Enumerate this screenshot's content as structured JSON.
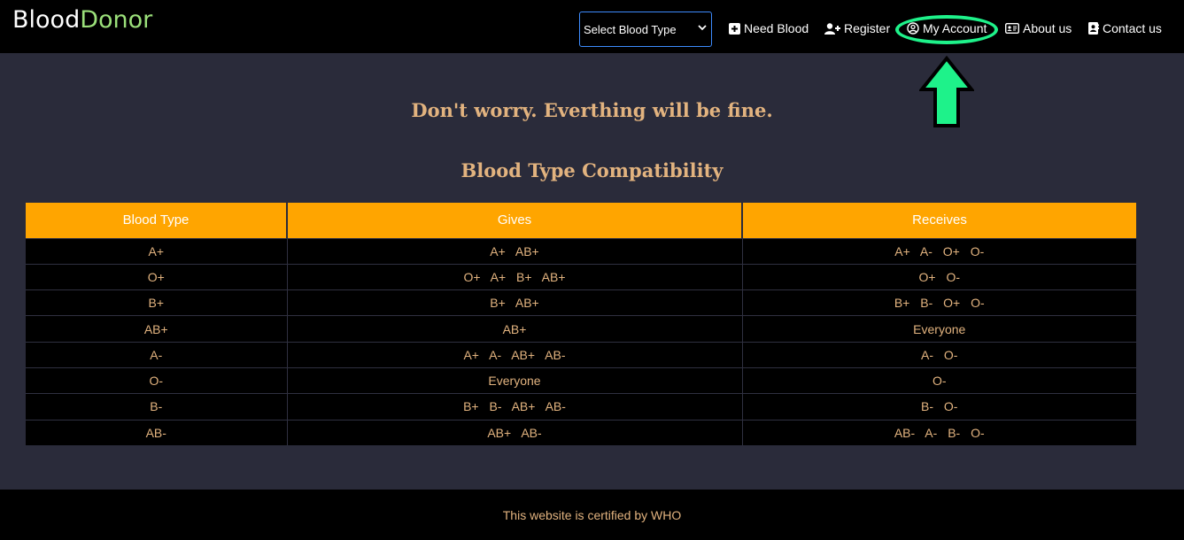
{
  "navbar": {
    "brand_primary": "Blood",
    "brand_accent": "Donor",
    "select_value": "Select Blood Type",
    "items": [
      {
        "label": "Need Blood",
        "icon": "plus-square-icon"
      },
      {
        "label": "Register",
        "icon": "user-plus-icon"
      },
      {
        "label": "My Account",
        "icon": "user-circle-icon"
      },
      {
        "label": "About us",
        "icon": "id-card-icon"
      },
      {
        "label": "Contact us",
        "icon": "address-book-icon"
      }
    ]
  },
  "main": {
    "tagline": "Don't worry. Everthing will be fine.",
    "table_title": "Blood Type Compatibility",
    "table": {
      "headers": [
        "Blood Type",
        "Gives",
        "Receives"
      ],
      "rows": [
        [
          "A+",
          "A+ AB+",
          "A+ A- O+ O-"
        ],
        [
          "O+",
          "O+ A+ B+ AB+",
          "O+ O-"
        ],
        [
          "B+",
          "B+ AB+",
          "B+ B- O+ O-"
        ],
        [
          "AB+",
          "AB+",
          "Everyone"
        ],
        [
          "A-",
          "A+ A- AB+ AB-",
          "A- O-"
        ],
        [
          "O-",
          "Everyone",
          "O-"
        ],
        [
          "B-",
          "B+ B- AB+ AB-",
          "B- O-"
        ],
        [
          "AB-",
          "AB+ AB-",
          "AB- A- B- O-"
        ]
      ]
    }
  },
  "footer": {
    "text": "This website is certified by WHO"
  },
  "colors": {
    "accent_green": "#9be07a",
    "header_orange": "#ffa500",
    "text_tan": "#e2b37f",
    "highlight_green": "#1ef28a"
  }
}
